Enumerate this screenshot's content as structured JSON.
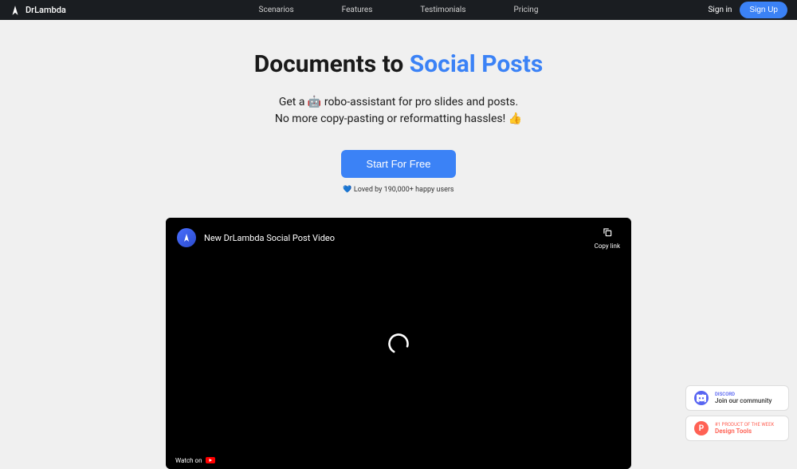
{
  "header": {
    "logo": "DrLambda",
    "nav": {
      "scenarios": "Scenarios",
      "features": "Features",
      "testimonials": "Testimonials",
      "pricing": "Pricing"
    },
    "signin": "Sign in",
    "signup": "Sign Up"
  },
  "hero": {
    "title_prefix": "Documents to ",
    "title_highlight": "Social Posts",
    "subtitle_line1": "Get a 🤖 robo-assistant for pro slides and posts.",
    "subtitle_line2": "No more copy-pasting or reformatting hassles! 👍",
    "cta": "Start For Free",
    "loved_by": "💙 Loved by 190,000+ happy users"
  },
  "video": {
    "title": "New DrLambda Social Post Video",
    "copy_link": "Copy link",
    "watch_on": "Watch on"
  },
  "badges": {
    "discord": {
      "label": "DISCORD",
      "title": "Join our community"
    },
    "producthunt": {
      "label": "#1 PRODUCT OF THE WEEK",
      "title": "Design Tools"
    }
  }
}
